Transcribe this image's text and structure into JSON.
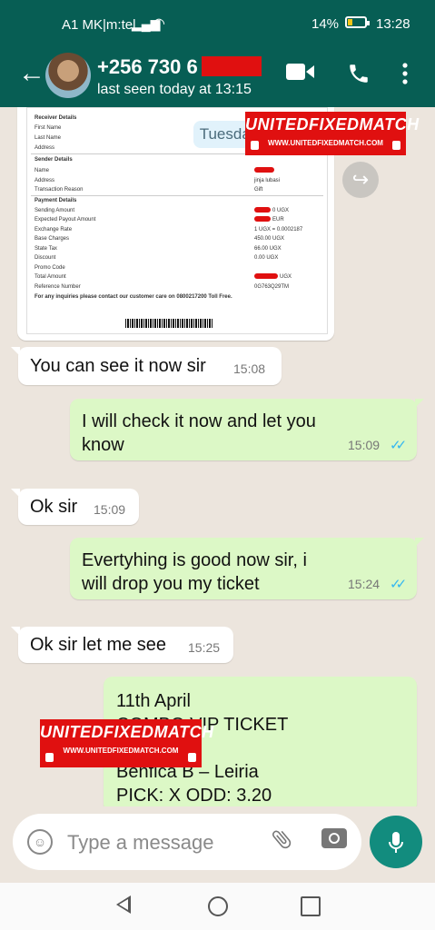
{
  "status_bar": {
    "carrier": "A1 MK|m:tel",
    "battery": "14%",
    "time": "13:28"
  },
  "header": {
    "contact": "+256 730 6",
    "last_seen": "last seen today at 13:15"
  },
  "receipt": {
    "receiver_header": "Receiver Details",
    "first_name": "First Name",
    "last_name": "Last Name",
    "address": "Address",
    "sender_header": "Sender Details",
    "name": "Name",
    "sender_address": "Address",
    "sender_address_value": "jinja lubasi",
    "transaction_reason": "Transaction Reason",
    "transaction_reason_value": "Gift",
    "payment_header": "Payment Details",
    "sending_amount": "Sending Amount",
    "sending_amount_value": "0 UGX",
    "expected_payout": "Expected Payout Amount",
    "expected_payout_value": "EUR",
    "exchange_rate": "Exchange Rate",
    "exchange_rate_value": "1 UGX = 0.0002187",
    "base_charges": "Base Charges",
    "base_charges_value": "450.00 UGX",
    "state_tax": "State Tax",
    "state_tax_value": "66.00 UGX",
    "discount": "Discount",
    "discount_value": "0.00 UGX",
    "promo_code": "Promo Code",
    "total_amount": "Total Amount",
    "total_amount_value": "UGX",
    "reference_number": "Reference Number",
    "reference_number_value": "0G763Q29TM",
    "footer": "For any inquiries please contact our customer care on 0800217200 Toll Free."
  },
  "date_chip": "Tuesday",
  "watermark": {
    "title": "UNITEDFIXEDMATCH",
    "url": "WWW.UNITEDFIXEDMATCH.COM"
  },
  "messages": [
    {
      "dir": "in",
      "text": "You can see it now sir",
      "time": "15:08"
    },
    {
      "dir": "out",
      "text": "I will check it now and let you know",
      "time": "15:09"
    },
    {
      "dir": "in",
      "text": "Ok sir",
      "time": "15:09"
    },
    {
      "dir": "out",
      "text": "Evertyhing is good now sir, i will drop you my ticket",
      "time": "15:24"
    },
    {
      "dir": "in",
      "text": "Ok sir let me see",
      "time": "15:25"
    }
  ],
  "ticket": {
    "line1": "11th April",
    "line2": "COMBO VIP TICKET",
    "line3": "Benfica B – Leiria",
    "line4": "PICK: X ODD: 3.20"
  },
  "composer": {
    "placeholder": "Type a message"
  },
  "colors": {
    "header": "#075e54",
    "outgoing": "#dcf8c6",
    "incoming": "#ffffff",
    "mic": "#128c7e",
    "ticks": "#34b7f1",
    "watermark": "#e01010"
  }
}
